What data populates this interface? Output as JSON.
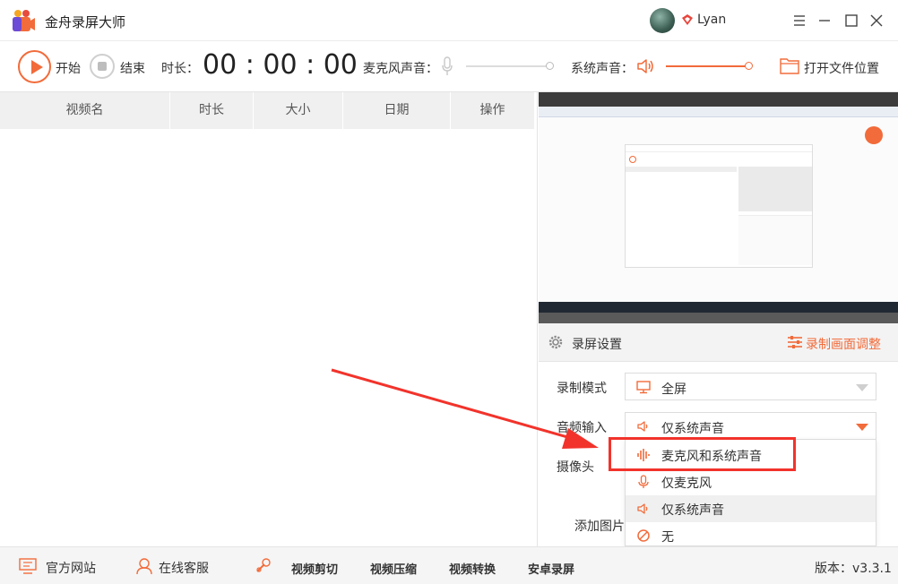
{
  "app": {
    "title": "金舟录屏大师",
    "username": "Lyan"
  },
  "toolbar": {
    "start_label": "开始",
    "stop_label": "结束",
    "duration_label": "时长：",
    "timer": "00 : 00 : 00",
    "mic_label": "麦克风声音：",
    "mic_volume_fraction": 0.0,
    "system_label": "系统声音：",
    "system_volume_fraction": 1.0,
    "open_folder_label": "打开文件位置"
  },
  "table": {
    "headers": [
      "视频名",
      "时长",
      "大小",
      "日期",
      "操作"
    ]
  },
  "settings": {
    "title": "录屏设置",
    "adjust_label": "录制画面调整",
    "mode_label": "录制模式",
    "mode_value": "全屏",
    "audio_label": "音频输入",
    "audio_value": "仅系统声音",
    "camera_label": "摄像头",
    "add_image_label": "添加图片"
  },
  "audio_dropdown": {
    "options": [
      "麦克风和系统声音",
      "仅麦克风",
      "仅系统声音",
      "无"
    ],
    "selected_index": 2
  },
  "footer": {
    "website": "官方网站",
    "support": "在线客服",
    "cut": "视频剪切",
    "compress": "视频压缩",
    "convert": "视频转换",
    "android": "安卓录屏",
    "version": "版本：v3.3.1"
  },
  "colors": {
    "accent": "#f26b3a",
    "annotation_red": "#f2332b"
  }
}
